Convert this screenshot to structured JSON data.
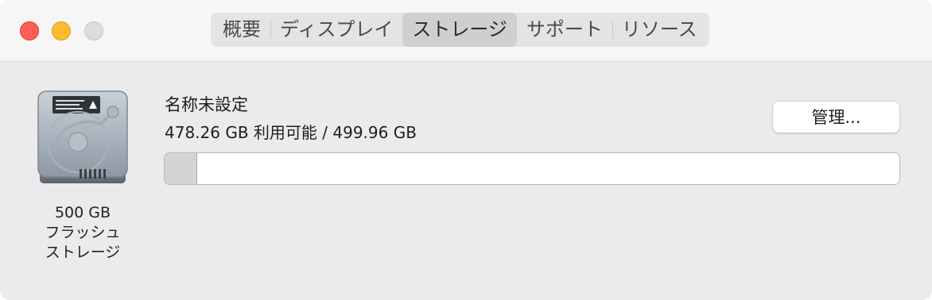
{
  "window": {
    "traffic_lights": [
      "close",
      "minimize",
      "zoom"
    ]
  },
  "tabs": [
    {
      "label": "概要",
      "active": false
    },
    {
      "label": "ディスプレイ",
      "active": false
    },
    {
      "label": "ストレージ",
      "active": true
    },
    {
      "label": "サポート",
      "active": false
    },
    {
      "label": "リソース",
      "active": false
    }
  ],
  "storage": {
    "drive_icon": "hard-drive-icon",
    "capacity": "500 GB",
    "type_line1": "フラッシュ",
    "type_line2": "ストレージ",
    "volume_name": "名称未設定",
    "available_text": "478.26 GB 利用可能 / 499.96 GB",
    "available_gb": 478.26,
    "total_gb": 499.96,
    "manage_label": "管理..."
  },
  "colors": {
    "close": "#fe5f57",
    "minimize": "#febc2e",
    "zoom_inactive": "#dcdcdc",
    "bar_used": "#d4d4d4"
  }
}
